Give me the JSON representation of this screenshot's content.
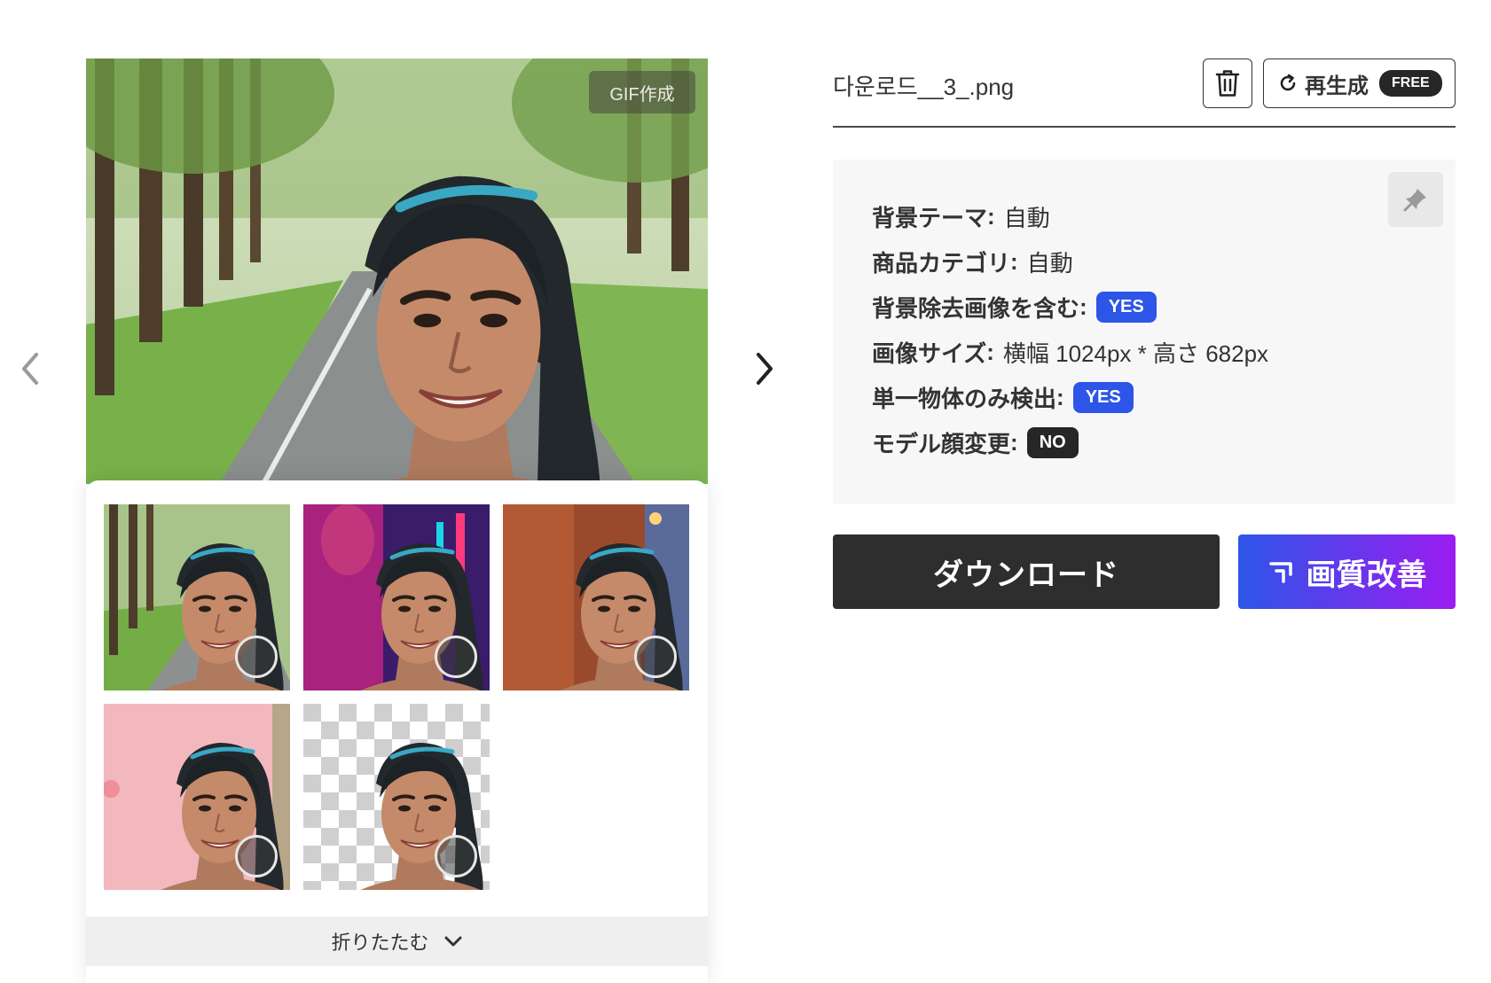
{
  "navigation": {
    "prev_icon": "chevron-left-icon",
    "next_icon": "chevron-right-icon"
  },
  "preview": {
    "gif_button_label": "GIF作成"
  },
  "thumbnails": [
    {
      "background": "park-path"
    },
    {
      "background": "neon-night"
    },
    {
      "background": "brick-street"
    },
    {
      "background": "pink-studio"
    },
    {
      "background": "transparent"
    }
  ],
  "collapse": {
    "label": "折りたたむ",
    "icon": "chevron-down-icon"
  },
  "file": {
    "title": "다운로드__3_.png"
  },
  "toolbar": {
    "delete_icon": "trash-icon",
    "regenerate_label": "再生成",
    "regenerate_icon": "refresh-icon",
    "free_badge": "FREE"
  },
  "info": {
    "pin_icon": "pin-icon",
    "rows": [
      {
        "key": "背景テーマ",
        "value": "自動"
      },
      {
        "key": "商品カテゴリ",
        "value": "自動"
      },
      {
        "key": "背景除去画像を含む",
        "badge": "YES",
        "badge_color": "#2d55e8"
      },
      {
        "key": "画像サイズ",
        "value": "横幅 1024px * 高さ 682px"
      },
      {
        "key": "単一物体のみ検出",
        "badge": "YES",
        "badge_color": "#2d55e8"
      },
      {
        "key": "モデル顔変更",
        "badge": "NO",
        "badge_color": "#262626"
      }
    ]
  },
  "actions": {
    "download_label": "ダウンロード",
    "enhance_label": "画質改善",
    "enhance_icon": "upscale-icon"
  },
  "colors": {
    "accent_blue": "#2d55e8",
    "accent_purple": "#9b1cf0",
    "dark": "#2e2e2e"
  }
}
